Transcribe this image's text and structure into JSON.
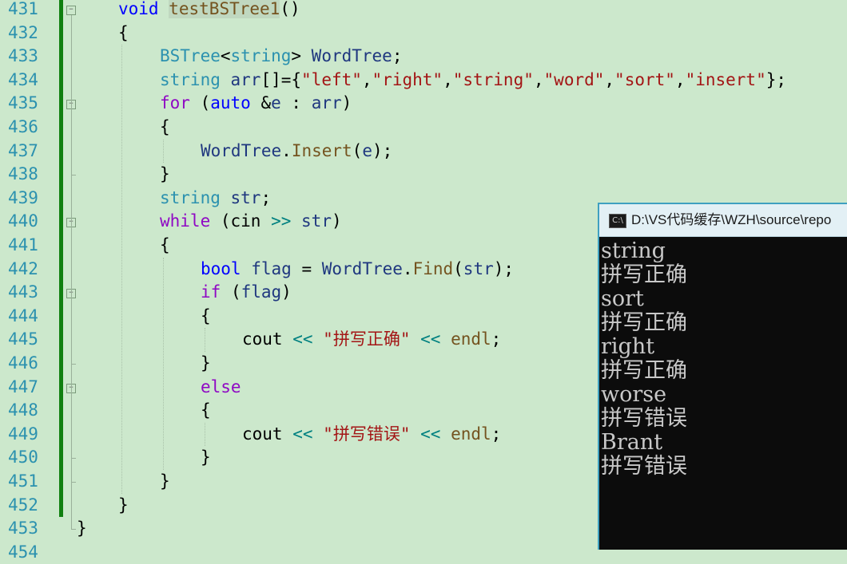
{
  "editor": {
    "lines": [
      {
        "num": "431",
        "tokens": [
          {
            "t": "void",
            "c": "kw"
          },
          {
            "t": " "
          },
          {
            "t": "testBSTree1",
            "c": "fn hl"
          },
          {
            "t": "()"
          }
        ]
      },
      {
        "num": "432",
        "tokens": [
          {
            "t": "{"
          }
        ]
      },
      {
        "num": "433",
        "tokens": [
          {
            "t": "BSTree",
            "c": "ty"
          },
          {
            "t": "<"
          },
          {
            "t": "string",
            "c": "ty"
          },
          {
            "t": "> "
          },
          {
            "t": "WordTree",
            "c": "var"
          },
          {
            "t": ";"
          }
        ]
      },
      {
        "num": "434",
        "tokens": [
          {
            "t": "string",
            "c": "ty"
          },
          {
            "t": " "
          },
          {
            "t": "arr",
            "c": "var"
          },
          {
            "t": "[]={"
          },
          {
            "t": "\"left\"",
            "c": "str"
          },
          {
            "t": ","
          },
          {
            "t": "\"right\"",
            "c": "str"
          },
          {
            "t": ","
          },
          {
            "t": "\"string\"",
            "c": "str"
          },
          {
            "t": ","
          },
          {
            "t": "\"word\"",
            "c": "str"
          },
          {
            "t": ","
          },
          {
            "t": "\"sort\"",
            "c": "str"
          },
          {
            "t": ","
          },
          {
            "t": "\"insert\"",
            "c": "str"
          },
          {
            "t": "};"
          }
        ]
      },
      {
        "num": "435",
        "tokens": [
          {
            "t": "for",
            "c": "kwp"
          },
          {
            "t": " ("
          },
          {
            "t": "auto",
            "c": "kw"
          },
          {
            "t": " &"
          },
          {
            "t": "e",
            "c": "var"
          },
          {
            "t": " : "
          },
          {
            "t": "arr",
            "c": "var"
          },
          {
            "t": ")"
          }
        ]
      },
      {
        "num": "436",
        "tokens": [
          {
            "t": "{"
          }
        ]
      },
      {
        "num": "437",
        "tokens": [
          {
            "t": "WordTree",
            "c": "var"
          },
          {
            "t": "."
          },
          {
            "t": "Insert",
            "c": "fn"
          },
          {
            "t": "("
          },
          {
            "t": "e",
            "c": "var"
          },
          {
            "t": ");"
          }
        ]
      },
      {
        "num": "438",
        "tokens": [
          {
            "t": "}"
          }
        ]
      },
      {
        "num": "439",
        "tokens": [
          {
            "t": "string",
            "c": "ty"
          },
          {
            "t": " "
          },
          {
            "t": "str",
            "c": "var"
          },
          {
            "t": ";"
          }
        ]
      },
      {
        "num": "440",
        "tokens": [
          {
            "t": "while",
            "c": "kwp"
          },
          {
            "t": " (cin "
          },
          {
            "t": ">>",
            "c": "op"
          },
          {
            "t": " "
          },
          {
            "t": "str",
            "c": "var"
          },
          {
            "t": ")"
          }
        ]
      },
      {
        "num": "441",
        "tokens": [
          {
            "t": "{"
          }
        ]
      },
      {
        "num": "442",
        "tokens": [
          {
            "t": "bool",
            "c": "kw"
          },
          {
            "t": " "
          },
          {
            "t": "flag",
            "c": "var"
          },
          {
            "t": " = "
          },
          {
            "t": "WordTree",
            "c": "var"
          },
          {
            "t": "."
          },
          {
            "t": "Find",
            "c": "fn"
          },
          {
            "t": "("
          },
          {
            "t": "str",
            "c": "var"
          },
          {
            "t": ");"
          }
        ]
      },
      {
        "num": "443",
        "tokens": [
          {
            "t": "if",
            "c": "kwp"
          },
          {
            "t": " ("
          },
          {
            "t": "flag",
            "c": "var"
          },
          {
            "t": ")"
          }
        ]
      },
      {
        "num": "444",
        "tokens": [
          {
            "t": "{"
          }
        ]
      },
      {
        "num": "445",
        "tokens": [
          {
            "t": "cout "
          },
          {
            "t": "<<",
            "c": "op"
          },
          {
            "t": " "
          },
          {
            "t": "\"拼写正确\"",
            "c": "str"
          },
          {
            "t": " "
          },
          {
            "t": "<<",
            "c": "op"
          },
          {
            "t": " "
          },
          {
            "t": "endl",
            "c": "fn"
          },
          {
            "t": ";"
          }
        ]
      },
      {
        "num": "446",
        "tokens": [
          {
            "t": "}"
          }
        ]
      },
      {
        "num": "447",
        "tokens": [
          {
            "t": "else",
            "c": "kwp"
          }
        ]
      },
      {
        "num": "448",
        "tokens": [
          {
            "t": "{"
          }
        ]
      },
      {
        "num": "449",
        "tokens": [
          {
            "t": "cout "
          },
          {
            "t": "<<",
            "c": "op"
          },
          {
            "t": " "
          },
          {
            "t": "\"拼写错误\"",
            "c": "str"
          },
          {
            "t": " "
          },
          {
            "t": "<<",
            "c": "op"
          },
          {
            "t": " "
          },
          {
            "t": "endl",
            "c": "fn"
          },
          {
            "t": ";"
          }
        ]
      },
      {
        "num": "450",
        "tokens": [
          {
            "t": "}"
          }
        ]
      },
      {
        "num": "451",
        "tokens": [
          {
            "t": "}"
          }
        ]
      },
      {
        "num": "452",
        "tokens": [
          {
            "t": "}"
          }
        ]
      },
      {
        "num": "453",
        "tokens": [
          {
            "t": "}"
          }
        ]
      },
      {
        "num": "454",
        "tokens": []
      }
    ]
  },
  "console": {
    "title": "D:\\VS代码缓存\\WZH\\source\\repo",
    "icon": "console-app-icon",
    "output": [
      "string",
      "拼写正确",
      "sort",
      "拼写正确",
      "right",
      "拼写正确",
      "worse",
      "拼写错误",
      "Brant",
      "拼写错误"
    ]
  },
  "colors": {
    "editor_bg": "#cce8cc",
    "line_number": "#2b91af",
    "keyword": "#0000ff",
    "control_keyword": "#8f08c4",
    "type": "#2b91af",
    "function": "#74531f",
    "string": "#a31515",
    "variable": "#1f377f",
    "change_bar": "#108010",
    "console_bg": "#0c0c0c",
    "console_text": "#c8c8c8"
  }
}
